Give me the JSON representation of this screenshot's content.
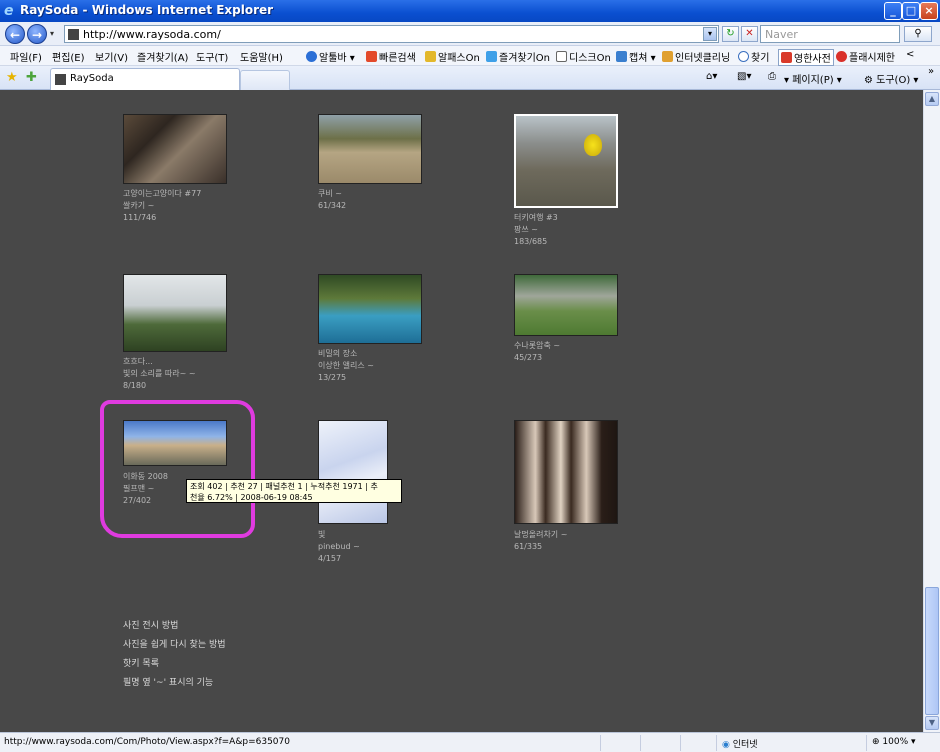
{
  "window": {
    "title": "RaySoda - Windows Internet Explorer",
    "minimize_glyph": "_",
    "maximize_glyph": "□",
    "close_glyph": "×",
    "ie_glyph": "e"
  },
  "address_bar": {
    "url": "http://www.raysoda.com/",
    "search_placeholder": "Naver",
    "back_glyph": "←",
    "forward_glyph": "→",
    "refresh_glyph": "↻",
    "stop_glyph": "✕",
    "search_go_glyph": "⚲",
    "dropdown_glyph": "▾"
  },
  "menu": {
    "items": [
      "파일(F)",
      "편집(E)",
      "보기(V)",
      "즐겨찾기(A)",
      "도구(T)",
      "도움말(H)"
    ],
    "toolbar_items": [
      "알툴바 ▾",
      "빠른검색",
      "알패스On",
      "즐겨찾기On",
      "디스크On",
      "캡쳐 ▾",
      "인터넷클리닝",
      "찾기",
      "영한사전",
      "플래시제한",
      "<"
    ]
  },
  "tabs": {
    "active_label": "RaySoda",
    "commands": [
      "▾",
      "▾",
      "▾ 페이지(P) ▾",
      "도구(O) ▾",
      "»"
    ]
  },
  "photos": [
    {
      "line1": "고양이는고양이다 #77",
      "line2": "쌀카기 ~",
      "line3": "111/746"
    },
    {
      "line1": "쿠비 ~",
      "line2": "61/342",
      "line3": ""
    },
    {
      "line1": "터키여행 #3",
      "line2": "팡쓰 ~",
      "line3": "183/685"
    },
    {
      "line1": "흐흐다...",
      "line2": "빛의 소리를 따라~ ~",
      "line3": "8/180"
    },
    {
      "line1": "비밀의 장소",
      "line2": "이상한 앨리스 ~",
      "line3": "13/275"
    },
    {
      "line1": "수나롯암축 ~",
      "line2": "45/273",
      "line3": ""
    },
    {
      "line1": "이화동 2008",
      "line2": "필프맨 ~",
      "line3": "27/402"
    },
    {
      "line1": "빛",
      "line2": "pinebud ~",
      "line3": "4/157"
    },
    {
      "line1": "날멍올려차기 ~",
      "line2": "61/335",
      "line3": ""
    }
  ],
  "tooltip": {
    "line1": "조회 402 | 추천 27 | 패널추천 1 | 누적추천 1971 | 추",
    "line2": "천율 6.72% | 2008-06-19 08:45"
  },
  "footer_links": [
    "사진 전시 방법",
    "사진을 쉽게 다시 찾는 방법",
    "핫키 목록",
    "필명 옆 '~' 표시의 기능"
  ],
  "status": {
    "url": "http://www.raysoda.com/Com/Photo/View.aspx?f=A&p=635070",
    "zone": "인터넷",
    "zoom": "100%"
  },
  "scrollbar": {
    "up_glyph": "▲",
    "down_glyph": "▼"
  },
  "colors": {
    "content_bg": "#484848",
    "highlight": "#e03be0",
    "tooltip_bg": "#ffffe1"
  }
}
